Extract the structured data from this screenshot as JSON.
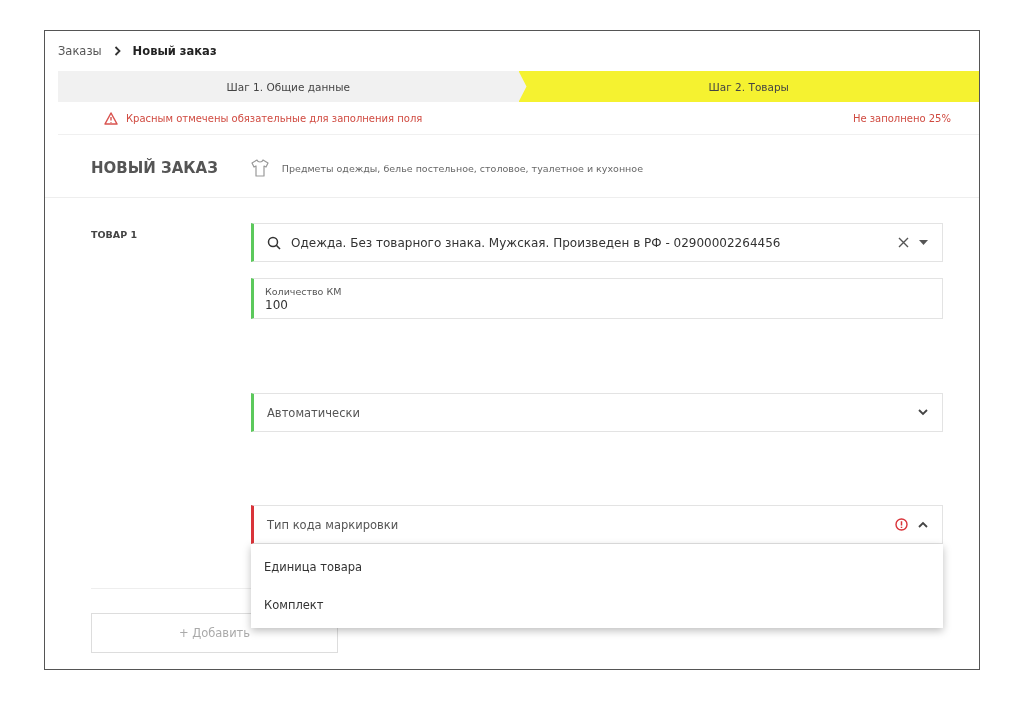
{
  "breadcrumb": {
    "parent": "Заказы",
    "current": "Новый заказ"
  },
  "steps": [
    {
      "label": "Шаг 1. Общие данные",
      "selected": false
    },
    {
      "label": "Шаг 2. Товары",
      "selected": true
    }
  ],
  "alert": {
    "message": "Красным отмечены обязательные для заполнения поля",
    "progress": "Не заполнено 25%"
  },
  "header": {
    "title": "НОВЫЙ ЗАКАЗ",
    "category": "Предметы одежды, белье постельное, столовое, туалетное и кухонное"
  },
  "product": {
    "label": "ТОВАР 1",
    "fields": [
      {
        "kind": "search",
        "value": "Одежда. Без товарного знака. Мужская. Произведен в РФ - 02900002264456",
        "error": false
      },
      {
        "kind": "text",
        "label": "Количество КМ",
        "value": "100",
        "error": false
      },
      {
        "kind": "select",
        "value": "Автоматически",
        "error": false,
        "expanded": false
      },
      {
        "kind": "select",
        "placeholder": "Тип кода маркировки",
        "error": true,
        "expanded": true,
        "options": [
          "Единица товара",
          "Комплект"
        ]
      }
    ]
  },
  "add_button": "+ Добавить"
}
